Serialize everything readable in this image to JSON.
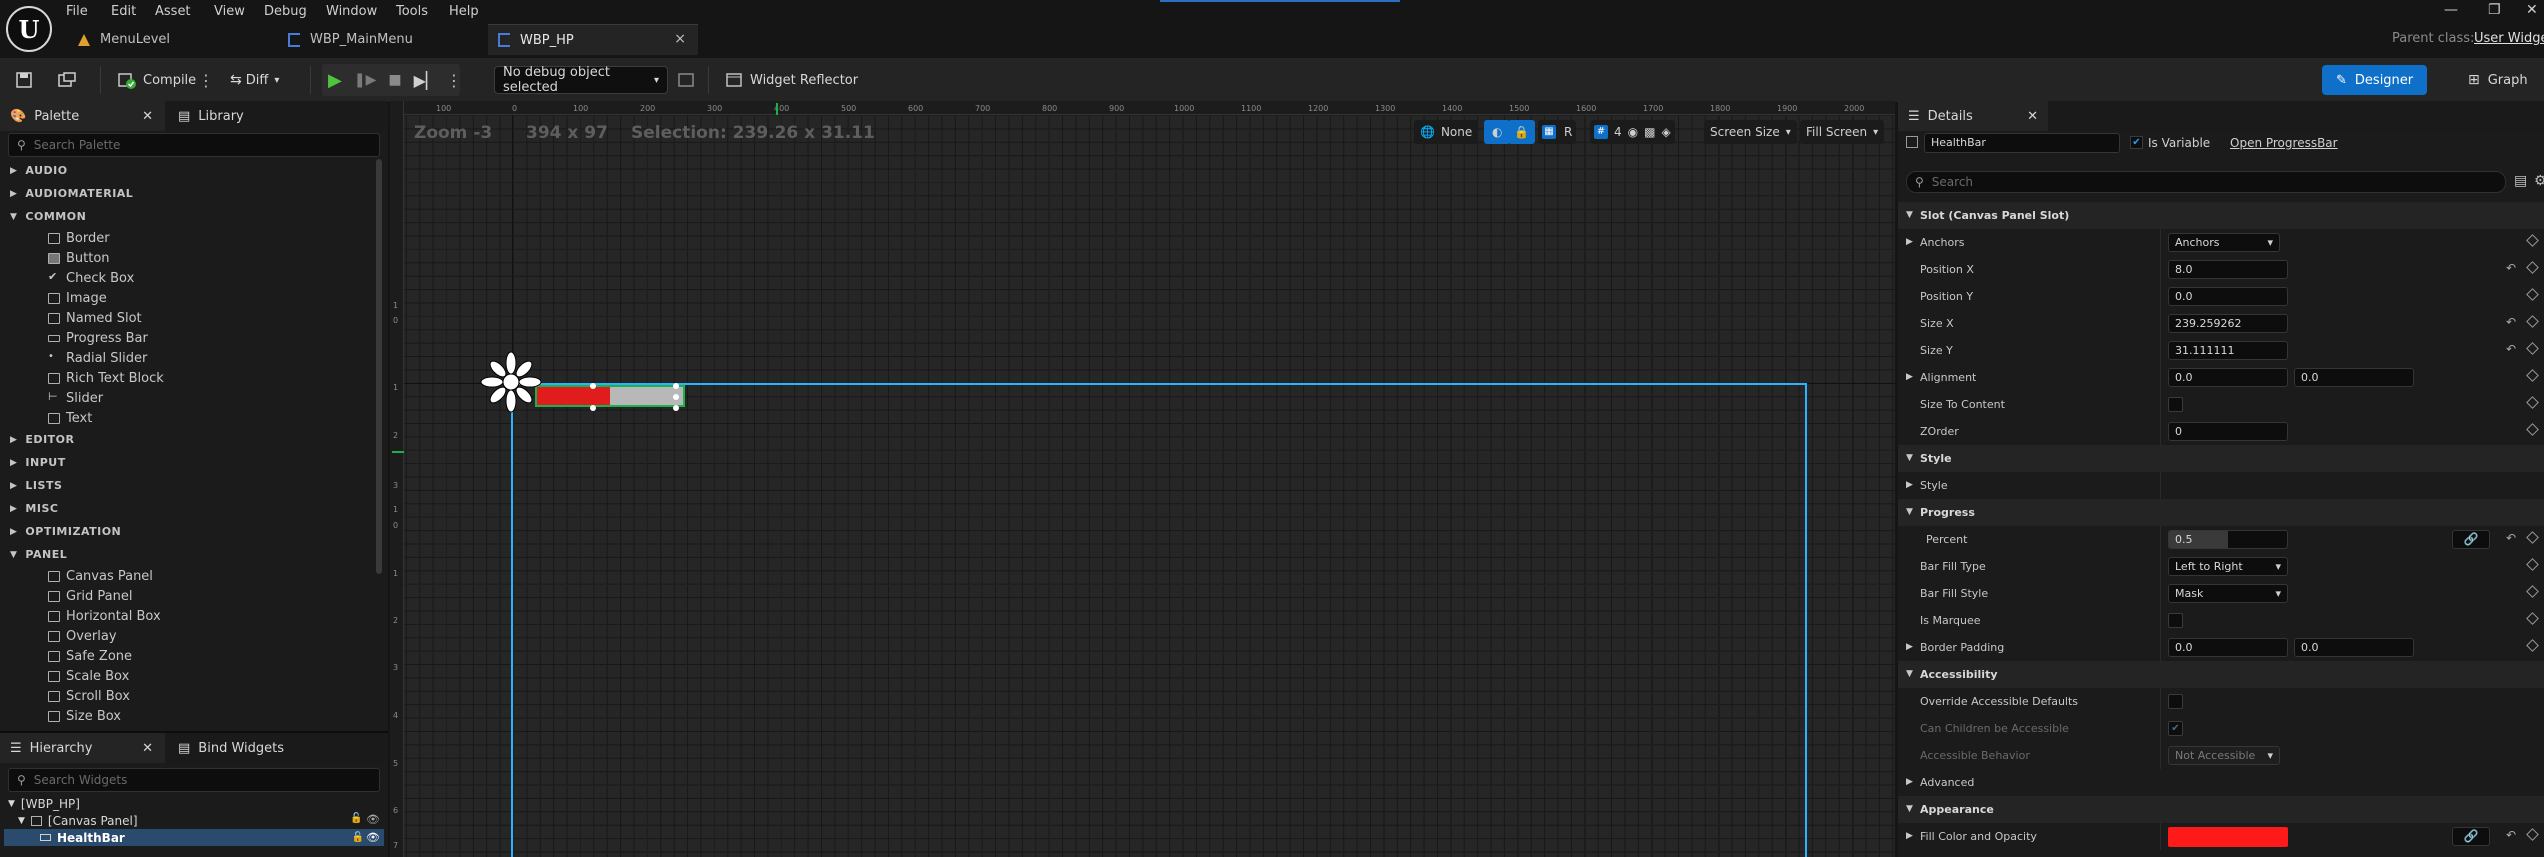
{
  "menubar": {
    "items": [
      "File",
      "Edit",
      "Asset",
      "View",
      "Debug",
      "Window",
      "Tools",
      "Help"
    ]
  },
  "tabs": [
    {
      "label": "MenuLevel"
    },
    {
      "label": "WBP_MainMenu"
    },
    {
      "label": "WBP_HP"
    }
  ],
  "tab_close": "×",
  "parent_class": {
    "label": "Parent class:",
    "value": "User Widget"
  },
  "window_controls": {
    "minimize": "—",
    "maximize": "❐",
    "close": "✕"
  },
  "toolbar": {
    "compile": "Compile",
    "diff": "Diff",
    "debug_object": "No debug object selected",
    "widget_reflector": "Widget Reflector",
    "designer": "Designer",
    "graph": "Graph"
  },
  "palette": {
    "title": "Palette",
    "library": "Library",
    "search_placeholder": "Search Palette",
    "categories_top": [
      "AUDIO",
      "AUDIOMATERIAL",
      "COMMON"
    ],
    "common_items": [
      "Border",
      "Button",
      "Check Box",
      "Image",
      "Named Slot",
      "Progress Bar",
      "Radial Slider",
      "Rich Text Block",
      "Slider",
      "Text"
    ],
    "categories_mid": [
      "EDITOR",
      "INPUT",
      "LISTS",
      "MISC",
      "OPTIMIZATION",
      "PANEL"
    ],
    "panel_items": [
      "Canvas Panel",
      "Grid Panel",
      "Horizontal Box",
      "Overlay",
      "Safe Zone",
      "Scale Box",
      "Scroll Box",
      "Size Box"
    ]
  },
  "hierarchy": {
    "title": "Hierarchy",
    "bind_widgets": "Bind Widgets",
    "search_placeholder": "Search Widgets",
    "root": "[WBP_HP]",
    "canvas": "[Canvas Panel]",
    "selected": "HealthBar"
  },
  "viewport": {
    "zoom": "Zoom -3",
    "size": "394 x 97",
    "selection": "Selection: 239.26 x 31.11",
    "localization": "None",
    "r_label": "R",
    "grid_snap": "4",
    "screen_size": "Screen Size",
    "fill_screen": "Fill Screen",
    "ruler_top": [
      "100",
      "0",
      "100",
      "200",
      "300",
      "400",
      "500",
      "600",
      "700",
      "800",
      "900",
      "1000",
      "1100",
      "1200",
      "1300",
      "1400",
      "1500",
      "1600",
      "1700",
      "1800",
      "1900",
      "2000"
    ],
    "ruler_left": [
      "1",
      "0",
      "1",
      "2",
      "3",
      "1",
      "0",
      "1",
      "2",
      "3",
      "4",
      "5",
      "6",
      "7"
    ]
  },
  "details": {
    "title": "Details",
    "name": "HealthBar",
    "is_variable": "Is Variable",
    "open_link": "Open ProgressBar",
    "search_placeholder": "Search",
    "slot_section": "Slot (Canvas Panel Slot)",
    "anchors_label": "Anchors",
    "anchors_value": "Anchors",
    "position_x_label": "Position X",
    "position_x": "8.0",
    "position_y_label": "Position Y",
    "position_y": "0.0",
    "size_x_label": "Size X",
    "size_x": "239.259262",
    "size_y_label": "Size Y",
    "size_y": "31.111111",
    "alignment_label": "Alignment",
    "alignment_x": "0.0",
    "alignment_y": "0.0",
    "size_to_content": "Size To Content",
    "zorder_label": "ZOrder",
    "zorder": "0",
    "style_section": "Style",
    "style_label": "Style",
    "progress_section": "Progress",
    "percent_label": "Percent",
    "percent": "0.5",
    "percent_fraction": 0.5,
    "bar_fill_type_label": "Bar Fill Type",
    "bar_fill_type": "Left to Right",
    "bar_fill_style_label": "Bar Fill Style",
    "bar_fill_style": "Mask",
    "is_marquee": "Is Marquee",
    "border_padding_label": "Border Padding",
    "border_padding_x": "0.0",
    "border_padding_y": "0.0",
    "accessibility_section": "Accessibility",
    "override_accessible": "Override Accessible Defaults",
    "can_children": "Can Children be Accessible",
    "accessible_behavior_label": "Accessible Behavior",
    "accessible_behavior": "Not Accessible",
    "advanced": "Advanced",
    "appearance_section": "Appearance",
    "fill_color_label": "Fill Color and Opacity",
    "fill_color": "#ff1a1a"
  },
  "colors": {
    "accent": "#0e70c9",
    "selection": "#2a9df4",
    "healthbar_fill": "#e01c1c",
    "healthbar_bg": "#b8b8b8"
  }
}
